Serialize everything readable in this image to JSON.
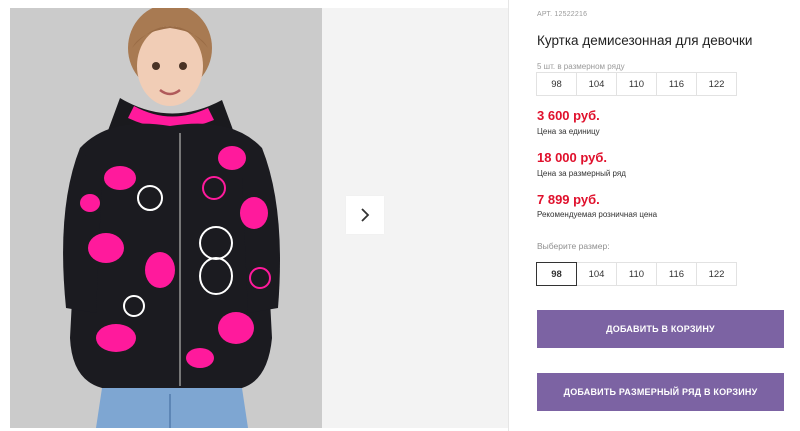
{
  "product": {
    "article": "АРТ. 12522216",
    "title": "Куртка демисезонная для девочки",
    "row_note": "5 шт. в размерном ряду",
    "row_sizes": [
      "98",
      "104",
      "110",
      "116",
      "122"
    ]
  },
  "prices": {
    "unit_price": "3 600 руб.",
    "unit_label": "Цена за единицу",
    "row_price": "18 000 руб.",
    "row_label": "Цена за размерный ряд",
    "retail_price": "7 899 руб.",
    "retail_label": "Рекомендуемая розничная цена"
  },
  "size_picker": {
    "label": "Выберите размер:",
    "options": [
      "98",
      "104",
      "110",
      "116",
      "122"
    ],
    "selected": "98"
  },
  "actions": {
    "add_to_cart": "ДОБАВИТЬ В КОРЗИНУ",
    "add_row_to_cart": "ДОБАВИТЬ РАЗМЕРНЫЙ РЯД В КОРЗИНУ"
  },
  "colors": {
    "price": "#e0102c",
    "button": "#7c63a3",
    "jacket_print": "#ff1a9c"
  }
}
